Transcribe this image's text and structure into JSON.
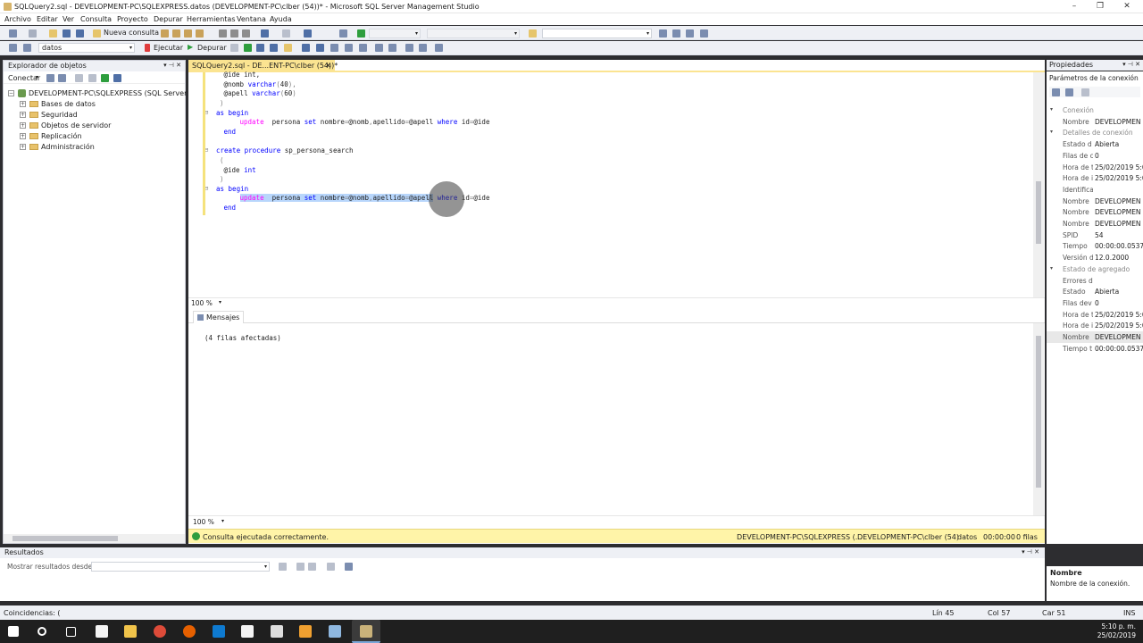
{
  "window": {
    "title": "SQLQuery2.sql - DEVELOPMENT-PC\\SQLEXPRESS.datos (DEVELOPMENT-PC\\clber (54))* - Microsoft SQL Server Management Studio"
  },
  "menu": [
    "Archivo",
    "Editar",
    "Ver",
    "Consulta",
    "Proyecto",
    "Depurar",
    "Herramientas",
    "Ventana",
    "Ayuda"
  ],
  "toolbar": {
    "new_query": "Nueva consulta",
    "database": "datos",
    "execute": "Ejecutar",
    "debug": "Depurar"
  },
  "object_explorer": {
    "title": "Explorador de objetos",
    "connect": "Conectar",
    "server": "DEVELOPMENT-PC\\SQLEXPRESS (SQL Server 12.0",
    "nodes": [
      "Bases de datos",
      "Seguridad",
      "Objetos de servidor",
      "Replicación",
      "Administración"
    ]
  },
  "editor": {
    "tab": "SQLQuery2.sql - DE...ENT-PC\\clber (54))*",
    "zoom": "100 %",
    "lines": [
      {
        "g": "   ",
        "parts": [
          [
            "",
            "@ide int,"
          ]
        ]
      },
      {
        "g": "   ",
        "parts": [
          [
            "",
            "@nomb "
          ],
          [
            "kw",
            "varchar"
          ],
          [
            "gy",
            "("
          ],
          [
            "",
            "40"
          ],
          [
            "gy",
            "),"
          ]
        ]
      },
      {
        "g": "   ",
        "parts": [
          [
            "",
            "@apell "
          ],
          [
            "kw",
            "varchar"
          ],
          [
            "gy",
            "("
          ],
          [
            "",
            "60"
          ],
          [
            "gy",
            ")"
          ]
        ]
      },
      {
        "g": "  ",
        "parts": [
          [
            "gy",
            ")"
          ]
        ]
      },
      {
        "g": "⊟",
        "parts": [
          [
            "kw",
            "as begin"
          ]
        ]
      },
      {
        "g": "       ",
        "parts": [
          [
            "kwp",
            "update"
          ],
          [
            "",
            "  persona "
          ],
          [
            "kw",
            "set"
          ],
          [
            "",
            " nombre"
          ],
          [
            "gy",
            "="
          ],
          [
            "",
            "@nomb"
          ],
          [
            "gy",
            ","
          ],
          [
            "",
            "apellido"
          ],
          [
            "gy",
            "="
          ],
          [
            "",
            "@apell "
          ],
          [
            "kw",
            "where"
          ],
          [
            "",
            " id"
          ],
          [
            "gy",
            "="
          ],
          [
            "",
            "@ide"
          ]
        ]
      },
      {
        "g": "   ",
        "parts": [
          [
            "kw",
            "end"
          ]
        ]
      },
      {
        "g": "",
        "parts": [
          [
            "",
            ""
          ]
        ]
      },
      {
        "g": "⊟",
        "parts": [
          [
            "kw",
            "create procedure"
          ],
          [
            "",
            " sp_persona_search"
          ]
        ]
      },
      {
        "g": "  ",
        "parts": [
          [
            "gy",
            "("
          ]
        ]
      },
      {
        "g": "   ",
        "parts": [
          [
            "",
            "@ide "
          ],
          [
            "kw",
            "int"
          ]
        ]
      },
      {
        "g": "  ",
        "parts": [
          [
            "gy",
            ")"
          ]
        ]
      },
      {
        "g": "⊟",
        "parts": [
          [
            "kw",
            "as begin"
          ]
        ]
      },
      {
        "g": "       ",
        "parts": [
          [
            "kwp sel",
            "update"
          ],
          [
            "sel",
            "  persona "
          ],
          [
            "kw sel",
            "set"
          ],
          [
            "sel",
            " nombre"
          ],
          [
            "gy sel",
            "="
          ],
          [
            "sel",
            "@nomb"
          ],
          [
            "gy sel",
            ","
          ],
          [
            "sel",
            "apellido"
          ],
          [
            "gy sel",
            "="
          ],
          [
            "sel",
            "@apell"
          ],
          [
            "",
            " "
          ],
          [
            "kw",
            "where"
          ],
          [
            "",
            " id"
          ],
          [
            "gy",
            "="
          ],
          [
            "",
            "@ide"
          ]
        ]
      },
      {
        "g": "   ",
        "parts": [
          [
            "kw",
            "end"
          ]
        ]
      }
    ]
  },
  "results": {
    "tab": "Mensajes",
    "message": "(4 filas afectadas)",
    "zoom": "100 %"
  },
  "query_status": {
    "message": "Consulta ejecutada correctamente.",
    "server": "DEVELOPMENT-PC\\SQLEXPRESS (...",
    "user": "DEVELOPMENT-PC\\clber (54)",
    "db": "datos",
    "time": "00:00:00",
    "rows": "0 filas"
  },
  "properties": {
    "title": "Propiedades",
    "selector": "Parámetros de la conexión",
    "rows": [
      {
        "cat": "Conexión"
      },
      {
        "k": "Nombre",
        "v": "DEVELOPMEN"
      },
      {
        "cat": "Detalles de conexión"
      },
      {
        "k": "Estado d",
        "v": "Abierta"
      },
      {
        "k": "Filas de c",
        "v": "0"
      },
      {
        "k": "Hora de t",
        "v": "25/02/2019 5:0"
      },
      {
        "k": "Hora de i",
        "v": "25/02/2019 5:0"
      },
      {
        "k": "Identifica",
        "v": ""
      },
      {
        "k": "Nombre",
        "v": "DEVELOPMEN"
      },
      {
        "k": "Nombre",
        "v": "DEVELOPMEN"
      },
      {
        "k": "Nombre",
        "v": "DEVELOPMEN"
      },
      {
        "k": "SPID",
        "v": "54"
      },
      {
        "k": "Tiempo",
        "v": "00:00:00.05375"
      },
      {
        "k": "Versión d",
        "v": "12.0.2000"
      },
      {
        "cat": "Estado de agregado"
      },
      {
        "k": "Errores d",
        "v": ""
      },
      {
        "k": "Estado",
        "v": "Abierta"
      },
      {
        "k": "Filas dev",
        "v": "0"
      },
      {
        "k": "Hora de t",
        "v": "25/02/2019 5:0"
      },
      {
        "k": "Hora de i",
        "v": "25/02/2019 5:0"
      },
      {
        "k": "Nombre",
        "v": "DEVELOPMEN"
      },
      {
        "k": "Tiempo t",
        "v": "00:00:00.05375"
      }
    ],
    "desc_title": "Nombre",
    "desc_text": "Nombre de la conexión."
  },
  "results_panel": {
    "title": "Resultados",
    "show_from": "Mostrar resultados desde:"
  },
  "statusbar": {
    "left": "Coincidencias: (",
    "line": "Lín 45",
    "col": "Col 57",
    "car": "Car 51",
    "ins": "INS"
  },
  "taskbar": {
    "time": "5:10 p. m.",
    "date": "25/02/2019"
  }
}
